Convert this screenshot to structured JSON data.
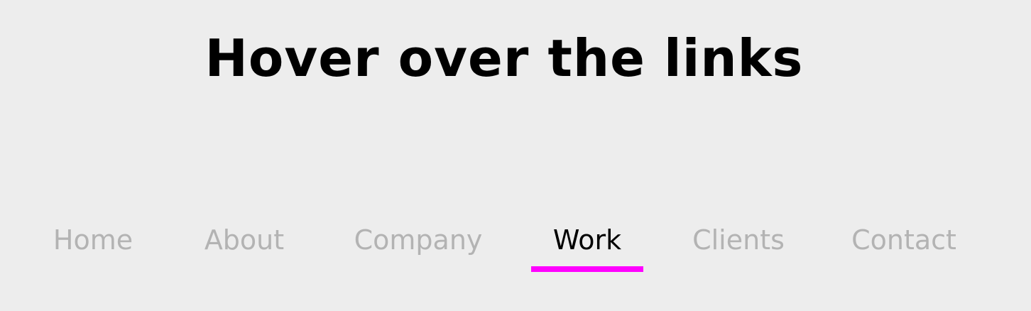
{
  "page": {
    "title": "Hover over the links"
  },
  "nav": {
    "items": [
      {
        "label": "Home",
        "active": false
      },
      {
        "label": "About",
        "active": false
      },
      {
        "label": "Company",
        "active": false
      },
      {
        "label": "Work",
        "active": true
      },
      {
        "label": "Clients",
        "active": false
      },
      {
        "label": "Contact",
        "active": false
      }
    ]
  },
  "colors": {
    "background": "#ededed",
    "title": "#000000",
    "link_inactive": "#b3b3b3",
    "link_active": "#000000",
    "underline_accent": "#ff00ff"
  }
}
